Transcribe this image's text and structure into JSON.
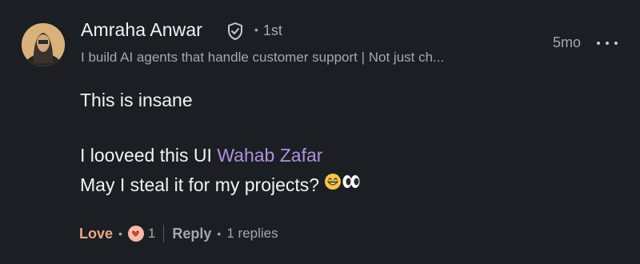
{
  "author": {
    "name": "Amraha Anwar",
    "degree": "1st",
    "headline": "I build AI agents that handle customer support | Not just ch...",
    "verified_icon": "shield-check-icon"
  },
  "meta": {
    "time": "5mo",
    "more_icon": "more-horizontal-icon"
  },
  "comment": {
    "line1": "This is insane",
    "line2_text": "I looveed this UI ",
    "mention": "Wahab Zafar",
    "line3_text": "May I steal it for my projects? ",
    "emojis": [
      "grinning-face",
      "eyes"
    ]
  },
  "actions": {
    "love_label": "Love",
    "reaction_icon": "heart-reaction-icon",
    "reaction_count": "1",
    "reply_label": "Reply",
    "reply_count": "1 replies"
  },
  "colors": {
    "background": "#1b1f23",
    "mention": "#b28fe0",
    "love": "#e9a882",
    "muted": "#a5a8ab"
  }
}
